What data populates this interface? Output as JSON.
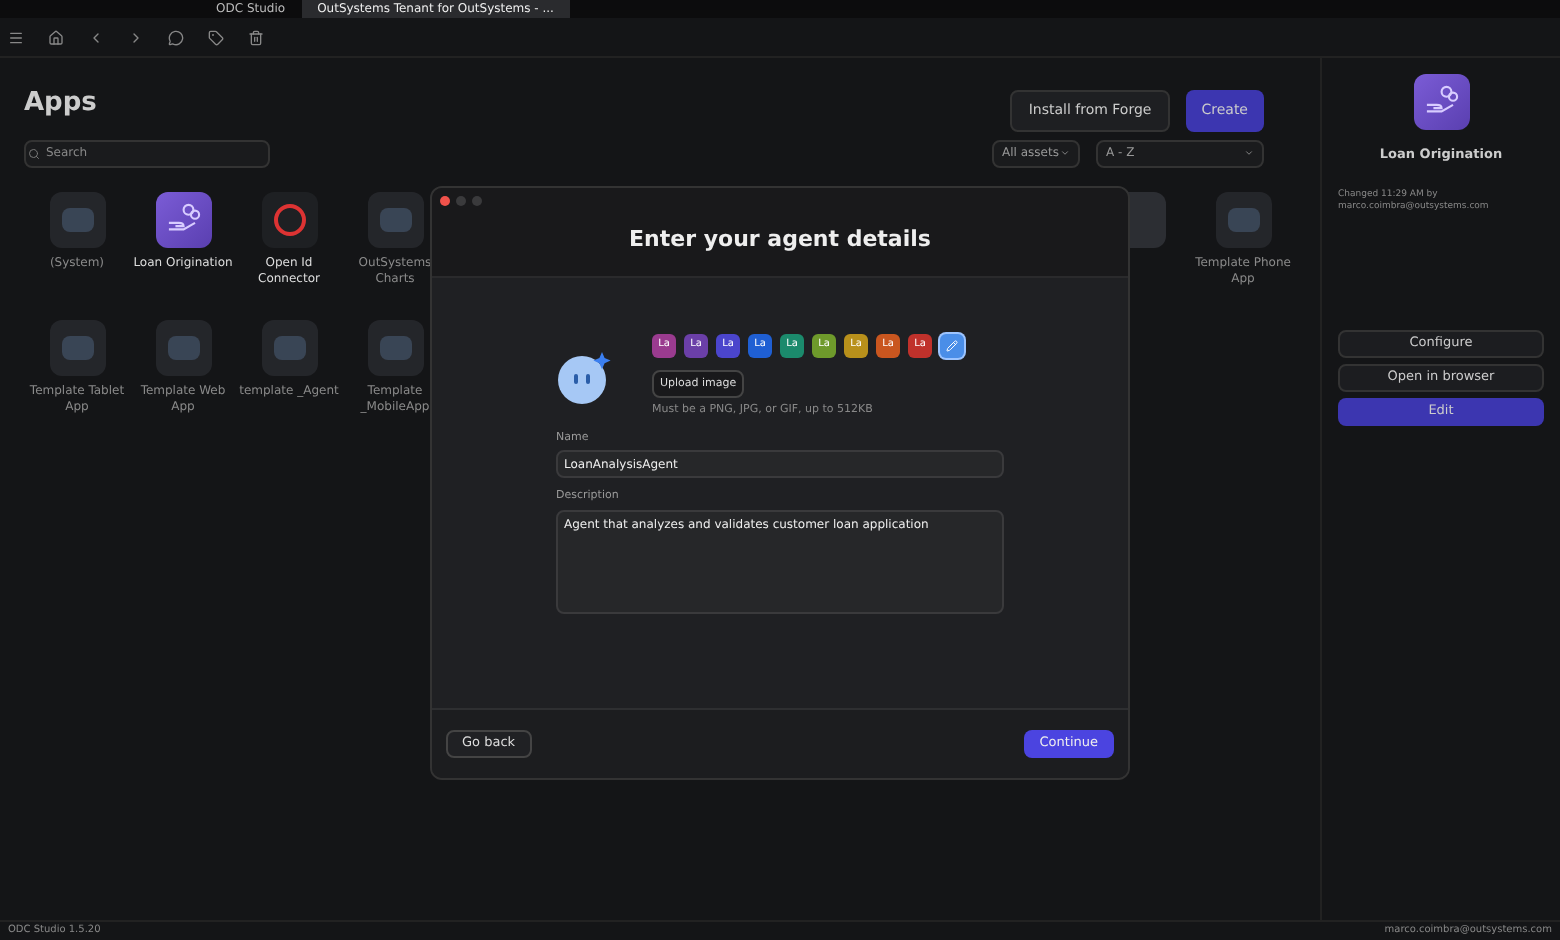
{
  "window": {
    "tabs": [
      {
        "label": "ODC Studio",
        "selected": false
      },
      {
        "label": "OutSystems Tenant for OutSystems - ...",
        "selected": true
      }
    ]
  },
  "apps": {
    "title": "Apps",
    "search": {
      "placeholder": "Search"
    },
    "install_button": "Install from Forge",
    "create_button": "Create",
    "filter": "All assets",
    "sort": "A - Z",
    "row_1": [
      {
        "name": "(System)",
        "dimmed": true
      },
      {
        "name": "Loan Origination",
        "dimmed": false
      },
      {
        "name": "Open Id Connector",
        "dimmed": false
      },
      {
        "name": "OutSystems Charts",
        "dimmed": true
      }
    ],
    "row_1_end": [
      {
        "name": "Template Phone App",
        "dimmed": true
      }
    ],
    "row_2": [
      {
        "name": "Template Tablet App",
        "dimmed": true
      },
      {
        "name": "Template Web App",
        "dimmed": true
      },
      {
        "name": "template _Agent",
        "dimmed": true
      },
      {
        "name": "Template _MobileApp",
        "dimmed": true
      }
    ]
  },
  "details": {
    "name": "Loan Origination",
    "changed": "Changed 11:29 AM by",
    "author": "marco.coimbra@outsystems.com",
    "buttons": [
      "Configure",
      "Open in browser",
      "Edit"
    ]
  },
  "dialog": {
    "title": "Enter your agent details",
    "avatar_options": [
      {
        "kind": "initials",
        "label": "La",
        "color": "#9a3b8f",
        "selected": false
      },
      {
        "kind": "initials",
        "label": "La",
        "color": "#6b3fa8",
        "selected": false
      },
      {
        "kind": "initials",
        "label": "La",
        "color": "#4b45cc",
        "selected": false
      },
      {
        "kind": "initials",
        "label": "La",
        "color": "#1f5fd3",
        "selected": false
      },
      {
        "kind": "initials",
        "label": "La",
        "color": "#1b8a6c",
        "selected": false
      },
      {
        "kind": "initials",
        "label": "La",
        "color": "#6e9a2b",
        "selected": false
      },
      {
        "kind": "initials",
        "label": "La",
        "color": "#b8901b",
        "selected": false
      },
      {
        "kind": "initials",
        "label": "La",
        "color": "#c9561f",
        "selected": false
      },
      {
        "kind": "initials",
        "label": "La",
        "color": "#c0312b",
        "selected": false
      },
      {
        "kind": "custom",
        "color": "#4a8ee8",
        "selected": true
      }
    ],
    "upload_button": "Upload image",
    "upload_hint": "Must be a PNG, JPG, or GIF, up to 512KB",
    "name_label": "Name",
    "name_value": "LoanAnalysisAgent",
    "description_label": "Description",
    "description_value": "Agent that analyzes and validates customer loan application",
    "back_button": "Go back",
    "continue_button": "Continue"
  },
  "status_bar": {
    "version": "ODC Studio 1.5.20",
    "account": "marco.coimbra@outsystems.com"
  }
}
